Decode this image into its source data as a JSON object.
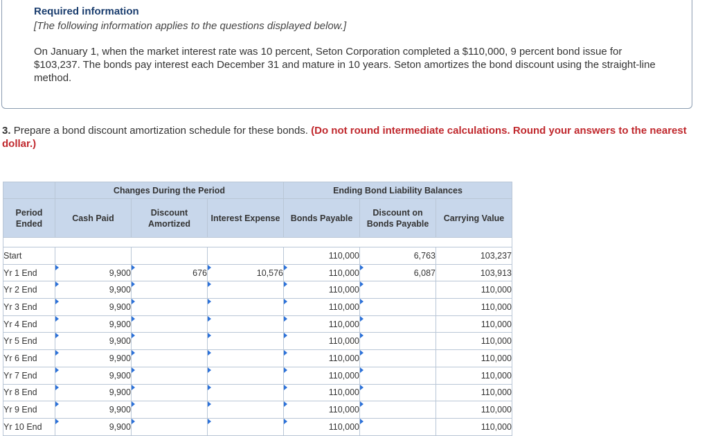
{
  "info": {
    "title": "Required information",
    "subtitle": "[The following information applies to the questions displayed below.]",
    "body": "On January 1, when the market interest rate was 10 percent, Seton Corporation completed a $110,000, 9 percent bond issue for $103,237. The bonds pay interest each December 31 and mature in 10 years. Seton amortizes the bond discount using the straight-line method."
  },
  "question": {
    "number": "3.",
    "text": "Prepare a bond discount amortization schedule for these bonds.",
    "instruction": "(Do not round intermediate calculations. Round your answers to the nearest dollar.)"
  },
  "table": {
    "group_headers": {
      "changes": "Changes During the Period",
      "ending": "Ending Bond Liability Balances"
    },
    "headers": {
      "period": "Period Ended",
      "cash_paid": "Cash Paid",
      "discount_amortized": "Discount Amortized",
      "interest_expense": "Interest Expense",
      "bonds_payable": "Bonds Payable",
      "discount_on_bonds": "Discount on Bonds Payable",
      "carrying_value": "Carrying Value"
    },
    "rows": [
      {
        "period": "Start",
        "cash_paid": "",
        "discount_amortized": "",
        "interest_expense": "",
        "bonds_payable": "110,000",
        "discount_on_bonds": "6,763",
        "carrying_value": "103,237"
      },
      {
        "period": "Yr 1 End",
        "cash_paid": "9,900",
        "discount_amortized": "676",
        "interest_expense": "10,576",
        "bonds_payable": "110,000",
        "discount_on_bonds": "6,087",
        "carrying_value": "103,913"
      },
      {
        "period": "Yr 2 End",
        "cash_paid": "9,900",
        "discount_amortized": "",
        "interest_expense": "",
        "bonds_payable": "110,000",
        "discount_on_bonds": "",
        "carrying_value": "110,000"
      },
      {
        "period": "Yr 3 End",
        "cash_paid": "9,900",
        "discount_amortized": "",
        "interest_expense": "",
        "bonds_payable": "110,000",
        "discount_on_bonds": "",
        "carrying_value": "110,000"
      },
      {
        "period": "Yr 4 End",
        "cash_paid": "9,900",
        "discount_amortized": "",
        "interest_expense": "",
        "bonds_payable": "110,000",
        "discount_on_bonds": "",
        "carrying_value": "110,000"
      },
      {
        "period": "Yr 5 End",
        "cash_paid": "9,900",
        "discount_amortized": "",
        "interest_expense": "",
        "bonds_payable": "110,000",
        "discount_on_bonds": "",
        "carrying_value": "110,000"
      },
      {
        "period": "Yr 6 End",
        "cash_paid": "9,900",
        "discount_amortized": "",
        "interest_expense": "",
        "bonds_payable": "110,000",
        "discount_on_bonds": "",
        "carrying_value": "110,000"
      },
      {
        "period": "Yr 7 End",
        "cash_paid": "9,900",
        "discount_amortized": "",
        "interest_expense": "",
        "bonds_payable": "110,000",
        "discount_on_bonds": "",
        "carrying_value": "110,000"
      },
      {
        "period": "Yr 8 End",
        "cash_paid": "9,900",
        "discount_amortized": "",
        "interest_expense": "",
        "bonds_payable": "110,000",
        "discount_on_bonds": "",
        "carrying_value": "110,000"
      },
      {
        "period": "Yr 9 End",
        "cash_paid": "9,900",
        "discount_amortized": "",
        "interest_expense": "",
        "bonds_payable": "110,000",
        "discount_on_bonds": "",
        "carrying_value": "110,000"
      },
      {
        "period": "Yr 10 End",
        "cash_paid": "9,900",
        "discount_amortized": "",
        "interest_expense": "",
        "bonds_payable": "110,000",
        "discount_on_bonds": "",
        "carrying_value": "110,000"
      }
    ]
  },
  "colors": {
    "header_bg": "#c8d7eb",
    "input_border": "#5b7fb5",
    "input_marker": "#2d72d9",
    "emphasis": "#c0282d",
    "title": "#1a3d6e"
  }
}
